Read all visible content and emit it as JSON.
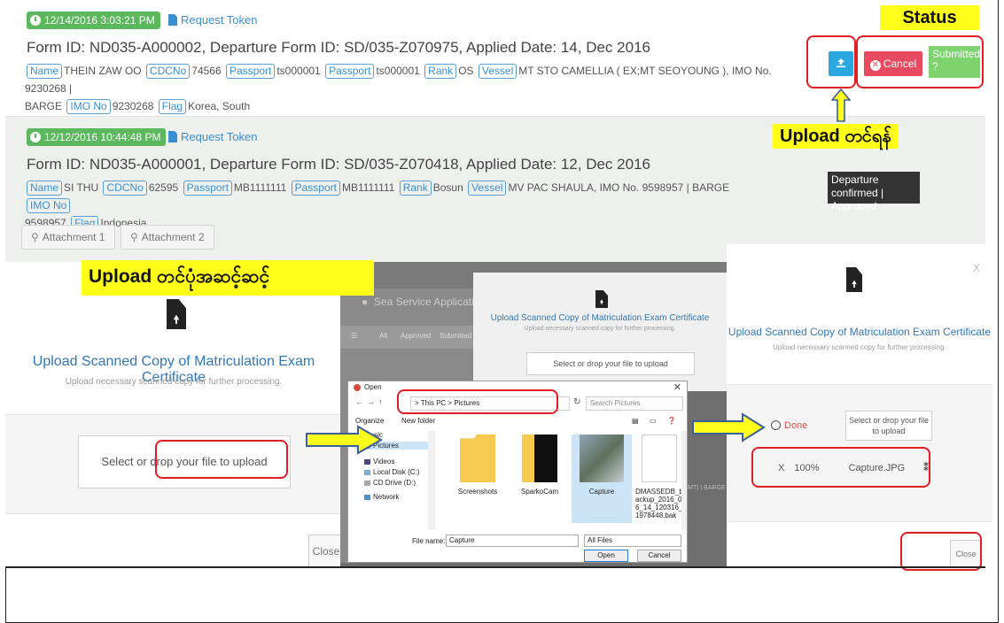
{
  "record1": {
    "timestamp": "12/14/2016 3:03:21 PM",
    "request_token": "Request Token",
    "form_line": "Form ID: ND035-A000002, Departure Form ID: SD/035-Z070975, Applied Date: 14, Dec 2016",
    "tag_name": "Name",
    "name_val": "THEIN ZAW OO",
    "tag_cdc": "CDCNo",
    "cdc_val": "74566",
    "tag_passport": "Passport",
    "passport_val": "ts000001",
    "tag_passport2": "Passport",
    "passport2_val": "ts000001",
    "tag_rank": "Rank",
    "rank_val": "OS",
    "tag_vessel": "Vessel",
    "vessel_val": "MT STO CAMELLIA ( EX;MT SEOYOUNG ), IMO No. 9230268 |",
    "line2_prefix": "BARGE",
    "tag_imo": "IMO No",
    "imo_val": "9230268",
    "tag_flag": "Flag",
    "flag_val": "Korea, South",
    "upload_icon": "upload-icon",
    "cancel_label": "Cancel",
    "status_badge": "Submitted ?"
  },
  "record2": {
    "timestamp": "12/12/2016 10:44:48 PM",
    "request_token": "Request Token",
    "form_line": "Form ID: ND035-A000001, Departure Form ID: SD/035-Z070418, Applied Date: 12, Dec 2016",
    "tag_name": "Name",
    "name_val": "SI THU",
    "tag_cdc": "CDCNo",
    "cdc_val": "62595",
    "tag_passport": "Passport",
    "passport_val": "MB1111111",
    "tag_passport2": "Passport",
    "passport2_val": "MB1111111",
    "tag_rank": "Rank",
    "rank_val": "Bosun",
    "tag_vessel": "Vessel",
    "vessel_val": "MV PAC SHAULA, IMO No. 9598957 | BARGE",
    "tag_imo": "IMO No",
    "line2_prefix": "9598957",
    "tag_flag": "Flag",
    "flag_val": "Indonesia",
    "status_badge": "Departure confirmed | Approved",
    "attachment1": "Attachment 1",
    "attachment2": "Attachment 2"
  },
  "callouts": {
    "status": "Status",
    "upload": "Upload တင်ရန်",
    "upload_method": "Upload တင်ပုံအဆင့်ဆင့်"
  },
  "modal_left": {
    "title": "Upload Scanned Copy of Matriculation Exam Certificate",
    "subtitle": "Upload necessary scanned copy for further processing.",
    "drop": "Select or drop your file to upload",
    "close": "Close"
  },
  "middle": {
    "app_title": "Sea Service Application U",
    "tab_all": "All",
    "tab_approved": "Approved",
    "tab_submitted": "Submitted",
    "panel_title": "Upload Scanned Copy of Matriculation Exam Certificate",
    "panel_sub": "Upload necessary scanned copy for further processing.",
    "panel_drop": "Select or drop your file to upload",
    "bg_text": "MT) | BARGE",
    "dialog": {
      "title": "Open",
      "address": "> This PC > Pictures",
      "search": "Search Pictures",
      "organize": "Organize",
      "new_folder": "New folder",
      "tree": [
        "Music",
        "Pictures",
        "Videos",
        "Local Disk (C:)",
        "CD Drive (D:)",
        "Network"
      ],
      "files": [
        "Screenshots",
        "SparkoCam",
        "Capture",
        "DMASSEDB_backup_2016_06_14_120316_1978448.bak"
      ],
      "file_name_label": "File name:",
      "file_name_value": "Capture",
      "file_type": "All Files",
      "open": "Open",
      "cancel": "Cancel"
    }
  },
  "modal_right": {
    "close_x": "X",
    "title": "Upload Scanned Copy of Matriculation Exam Certificate",
    "subtitle": "Upload necessary scanned copy for further processing.",
    "done": "Done",
    "drop": "Select or drop your file to upload",
    "progress_x": "X",
    "progress_pct": "100%",
    "file_name": "Capture.JPG",
    "pin_icon": "pin-icon",
    "close": "Close"
  },
  "colors": {
    "accent_blue": "#2aa7df",
    "cancel_red": "#e84a5f",
    "submitted_green": "#7fd36e",
    "timestamp_green": "#5cb85c",
    "callout_yellow": "#ffff1a",
    "highlight_red": "#e21d24"
  }
}
